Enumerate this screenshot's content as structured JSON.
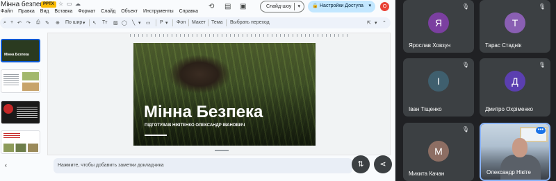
{
  "slides_app": {
    "doc_title": "Мінна безпека",
    "file_badge": "PPTX",
    "menu": [
      "Файл",
      "Правка",
      "Вид",
      "Вставка",
      "Формат",
      "Слайд",
      "Объект",
      "Инструменты",
      "Справка"
    ],
    "slideshow_label": "Слайд-шоу",
    "share_label": "Настройки Доступа",
    "account_initial": "О",
    "toolbar": {
      "fit_label": "По шир",
      "background_label": "Фон",
      "layout_label": "Макет",
      "theme_label": "Тема",
      "transition_label": "Выбрать переход"
    },
    "slide": {
      "title": "Мінна Безпека",
      "subtitle": "ПІДГОТУВАВ НІКІТЕНКО ОЛЕКСАНДР ІВАНОВИЧ"
    },
    "notes_placeholder": "Нажмите, чтобы добавить заметки докладчика"
  },
  "participants": [
    {
      "name": "Ярослав Ховзун",
      "initial": "Я",
      "color": "#7b3fa0"
    },
    {
      "name": "Тарас Стаднік",
      "initial": "Т",
      "color": "#8a5fb3"
    },
    {
      "name": "Іван Тіщенко",
      "initial": "І",
      "color": "#3f5f6e"
    },
    {
      "name": "Дмитро Охріменко",
      "initial": "Д",
      "color": "#5b3fb0"
    },
    {
      "name": "Микита Качан",
      "initial": "М",
      "color": "#8d6e63"
    },
    {
      "name": "Олександр Нікіте",
      "initial": "",
      "color": ""
    }
  ]
}
